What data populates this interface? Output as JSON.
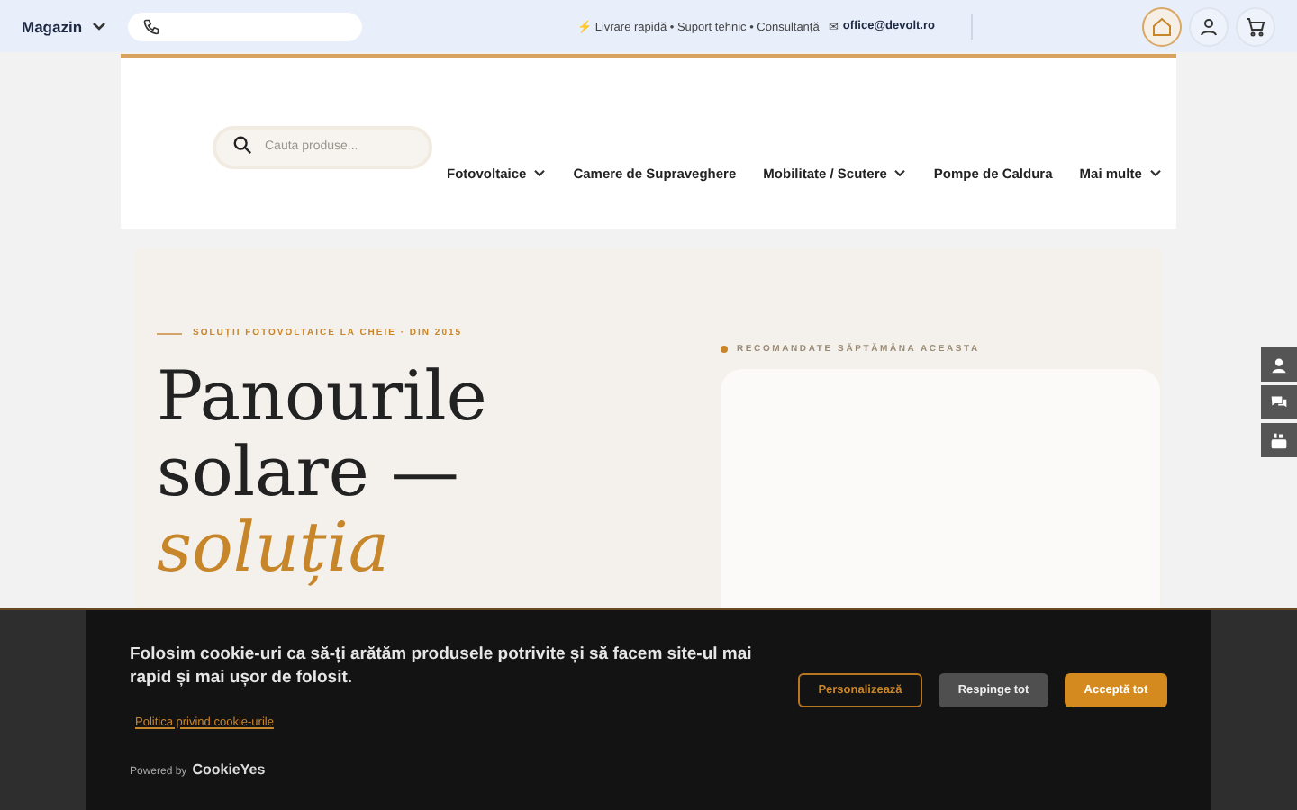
{
  "topbar": {
    "store_menu": "Magazin",
    "info": "⚡ Livrare rapidă • Suport tehnic • Consultanță",
    "email_icon": "✉",
    "email": "office@devolt.ro",
    "icons": [
      {
        "kind": "home",
        "selected": true
      },
      {
        "kind": "user",
        "selected": false
      },
      {
        "kind": "cart",
        "selected": false
      }
    ]
  },
  "header": {
    "search": {
      "placeholder": "Cauta produse..."
    },
    "nav": [
      {
        "label": "Fotovoltaice",
        "dropdown": true
      },
      {
        "label": "Camere de Supraveghere",
        "dropdown": false
      },
      {
        "label": "Mobilitate / Scutere",
        "dropdown": true
      },
      {
        "label": "Pompe de Caldura",
        "dropdown": false
      },
      {
        "label": "Mai multe",
        "dropdown": true
      }
    ]
  },
  "hero": {
    "eyebrow": "SOLUȚII FOTOVOLTAICE LA CHEIE · DIN 2015",
    "title_lines": [
      "Panourile",
      "solare —"
    ],
    "title_accent": "soluția",
    "recommended": "RECOMANDATE SĂPTĂMÂNA ACEASTA"
  },
  "side_icons": [
    {
      "kind": "user"
    },
    {
      "kind": "chat"
    },
    {
      "kind": "youtube"
    }
  ],
  "cookie_banner": {
    "message": "Folosim cookie-uri ca să-ți arătăm produsele potrivite și să facem site-ul mai rapid și mai ușor de folosit.",
    "policy_link": "Politica privind cookie-urile",
    "powered_by": "Powered by",
    "brand": "CookieYes",
    "buttons": [
      {
        "label": "Personalizează",
        "kind": "outline"
      },
      {
        "label": "Respinge tot",
        "kind": "neutral"
      },
      {
        "label": "Acceptă tot",
        "kind": "primary"
      }
    ]
  }
}
